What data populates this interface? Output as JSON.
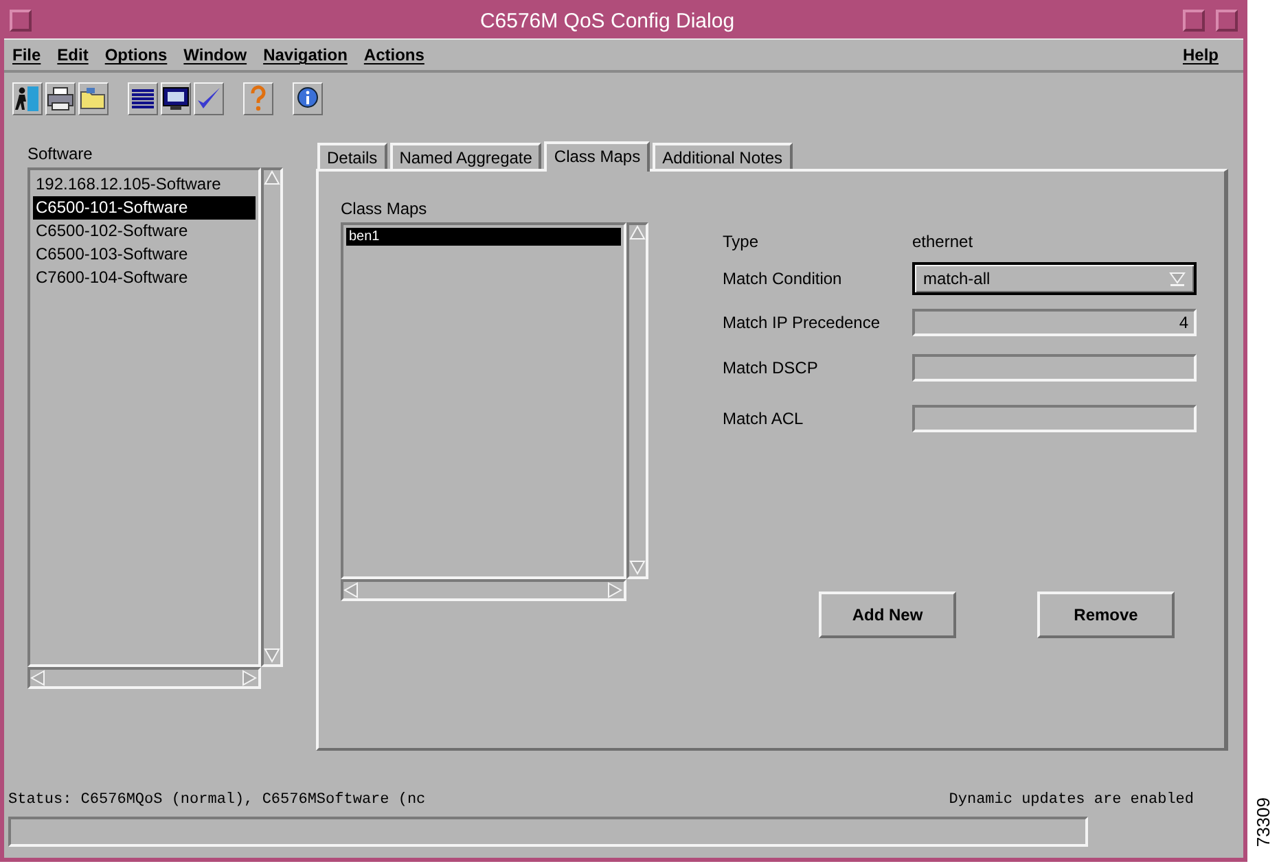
{
  "window": {
    "title": "C6576M QoS Config Dialog"
  },
  "menu": [
    {
      "label": "File"
    },
    {
      "label": "Edit"
    },
    {
      "label": "Options"
    },
    {
      "label": "Window"
    },
    {
      "label": "Navigation"
    },
    {
      "label": "Actions"
    }
  ],
  "menu_right": {
    "label": "Help"
  },
  "software": {
    "label": "Software",
    "items": [
      {
        "label": "192.168.12.105-Software",
        "selected": false
      },
      {
        "label": "C6500-101-Software",
        "selected": true
      },
      {
        "label": "C6500-102-Software",
        "selected": false
      },
      {
        "label": "C6500-103-Software",
        "selected": false
      },
      {
        "label": "C7600-104-Software",
        "selected": false
      }
    ]
  },
  "tabs": [
    {
      "label": "Details",
      "selected": false
    },
    {
      "label": "Named Aggregate",
      "selected": false
    },
    {
      "label": "Class Maps",
      "selected": true
    },
    {
      "label": "Additional Notes",
      "selected": false
    }
  ],
  "class_maps": {
    "label": "Class Maps",
    "items": [
      {
        "label": "ben1",
        "selected": true
      }
    ]
  },
  "form": [
    {
      "kind": "text",
      "label": "Type",
      "value": "ethernet"
    },
    {
      "kind": "select",
      "label": "Match Condition",
      "value": "match-all"
    },
    {
      "kind": "input",
      "label": "Match IP Precedence",
      "value": "4"
    },
    {
      "kind": "input",
      "label": "Match DSCP"
    },
    {
      "kind": "input",
      "label": "Match ACL"
    }
  ],
  "buttons": [
    "Add New",
    "Remove"
  ],
  "status_bar": {
    "status": "Status: C6576MQoS (normal), C6576MSoftware (nc",
    "updates": "Dynamic updates are enabled"
  },
  "progress": {
    "level": 0
  },
  "figure_number": "73309"
}
